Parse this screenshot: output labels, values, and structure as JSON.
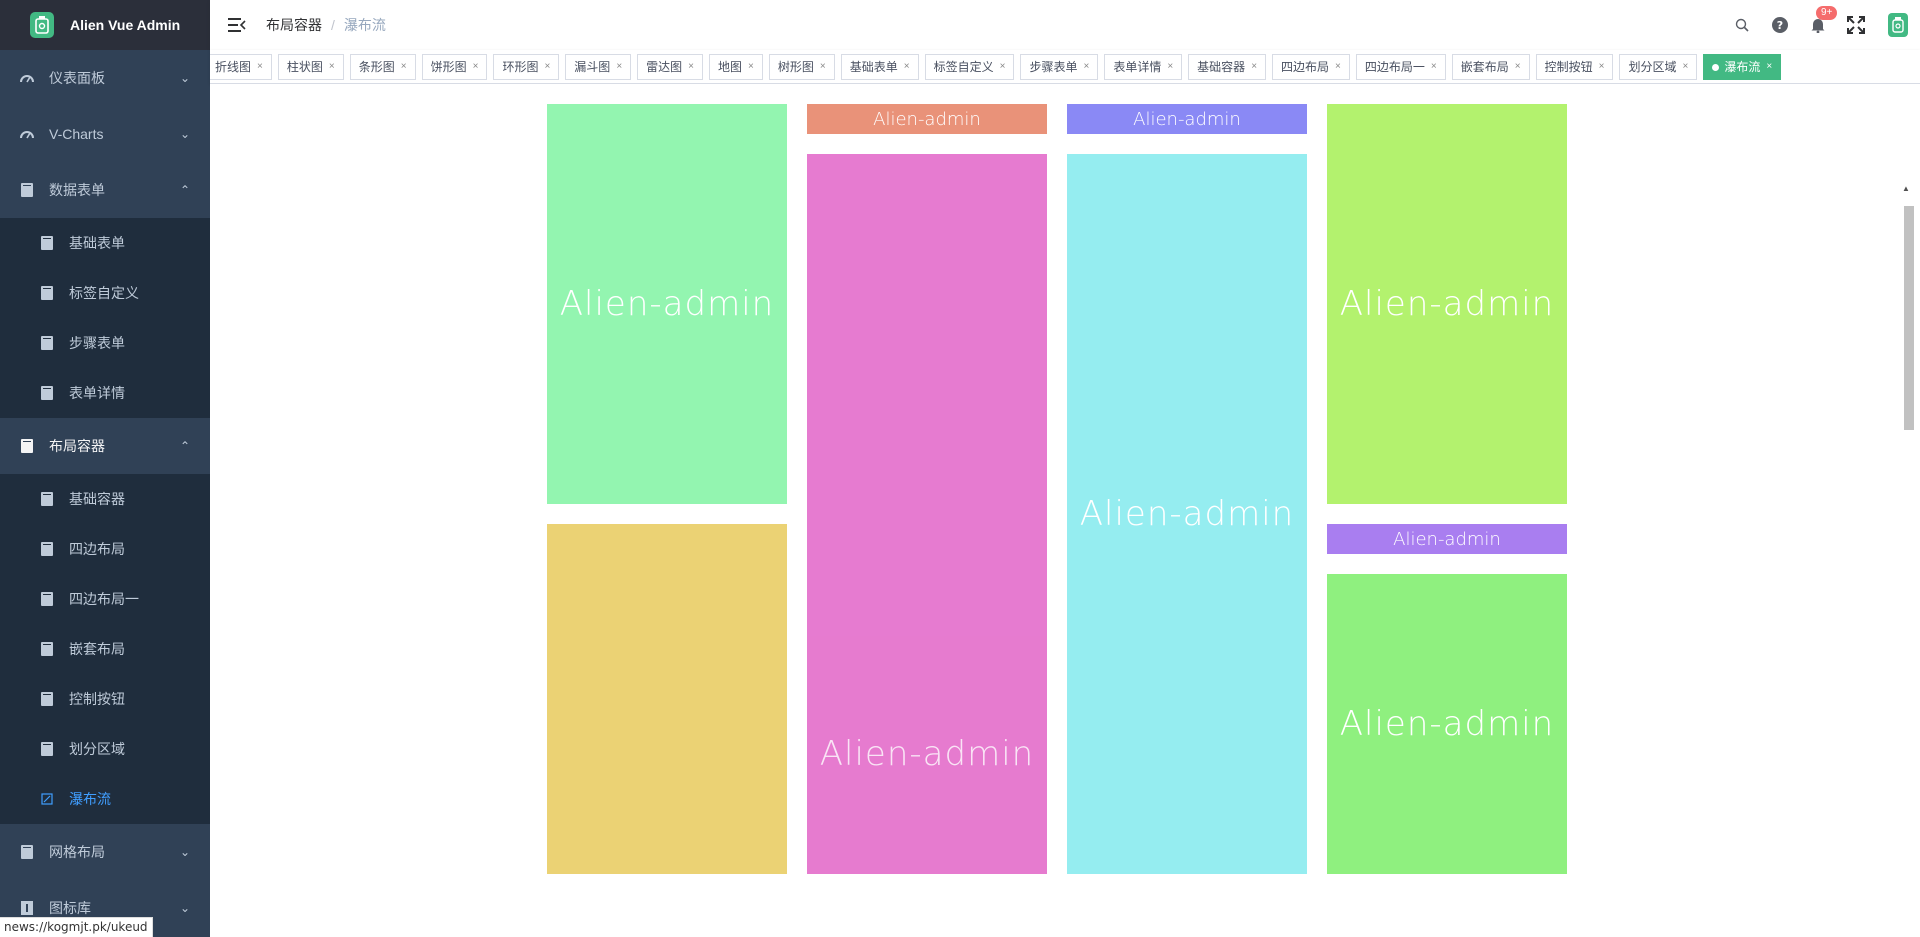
{
  "app": {
    "title": "Alien Vue Admin"
  },
  "sidebar": {
    "menus": [
      {
        "label": "仪表面板",
        "arrow": "down"
      },
      {
        "label": "V-Charts",
        "arrow": "down"
      },
      {
        "label": "数据表单",
        "arrow": "up"
      }
    ],
    "data_form_children": [
      "基础表单",
      "标签自定义",
      "步骤表单",
      "表单详情"
    ],
    "layout_menu": {
      "label": "布局容器",
      "arrow": "up"
    },
    "layout_children": [
      "基础容器",
      "四边布局",
      "四边布局一",
      "嵌套布局",
      "控制按钮",
      "划分区域",
      "瀑布流"
    ],
    "bottom_menus": [
      {
        "label": "网格布局",
        "arrow": "down"
      },
      {
        "label": "图标库",
        "arrow": "down"
      }
    ]
  },
  "header": {
    "breadcrumb": [
      "布局容器",
      "瀑布流"
    ],
    "breadcrumb_sep": "/",
    "notification_badge": "9+"
  },
  "tags": [
    "折线图",
    "柱状图",
    "条形图",
    "饼形图",
    "环形图",
    "漏斗图",
    "雷达图",
    "地图",
    "树形图",
    "基础表单",
    "标签自定义",
    "步骤表单",
    "表单详情",
    "基础容器",
    "四边布局",
    "四边布局一",
    "嵌套布局",
    "控制按钮",
    "划分区域",
    "瀑布流"
  ],
  "tag_close": "×",
  "waterfall": {
    "text": "Alien-admin",
    "colors": {
      "c1_top": "#93f5b0",
      "c1_bottom": "#ebd274",
      "c2_top": "#e99279",
      "c2_bottom": "#e574cd",
      "c3_top": "#8a89f5",
      "c3_bottom": "#95edf0",
      "c4_top": "#b3f26e",
      "c4_mid": "#a97ef0",
      "c4_bottom": "#8ff07f"
    }
  },
  "status_url": "news://kogmjt.pk/ukeud",
  "colors": {
    "sidebar_bg": "#304156",
    "submenu_bg": "#1f2d3d",
    "active_link": "#409eff",
    "brand": "#42b983",
    "badge": "#f56c6c"
  }
}
